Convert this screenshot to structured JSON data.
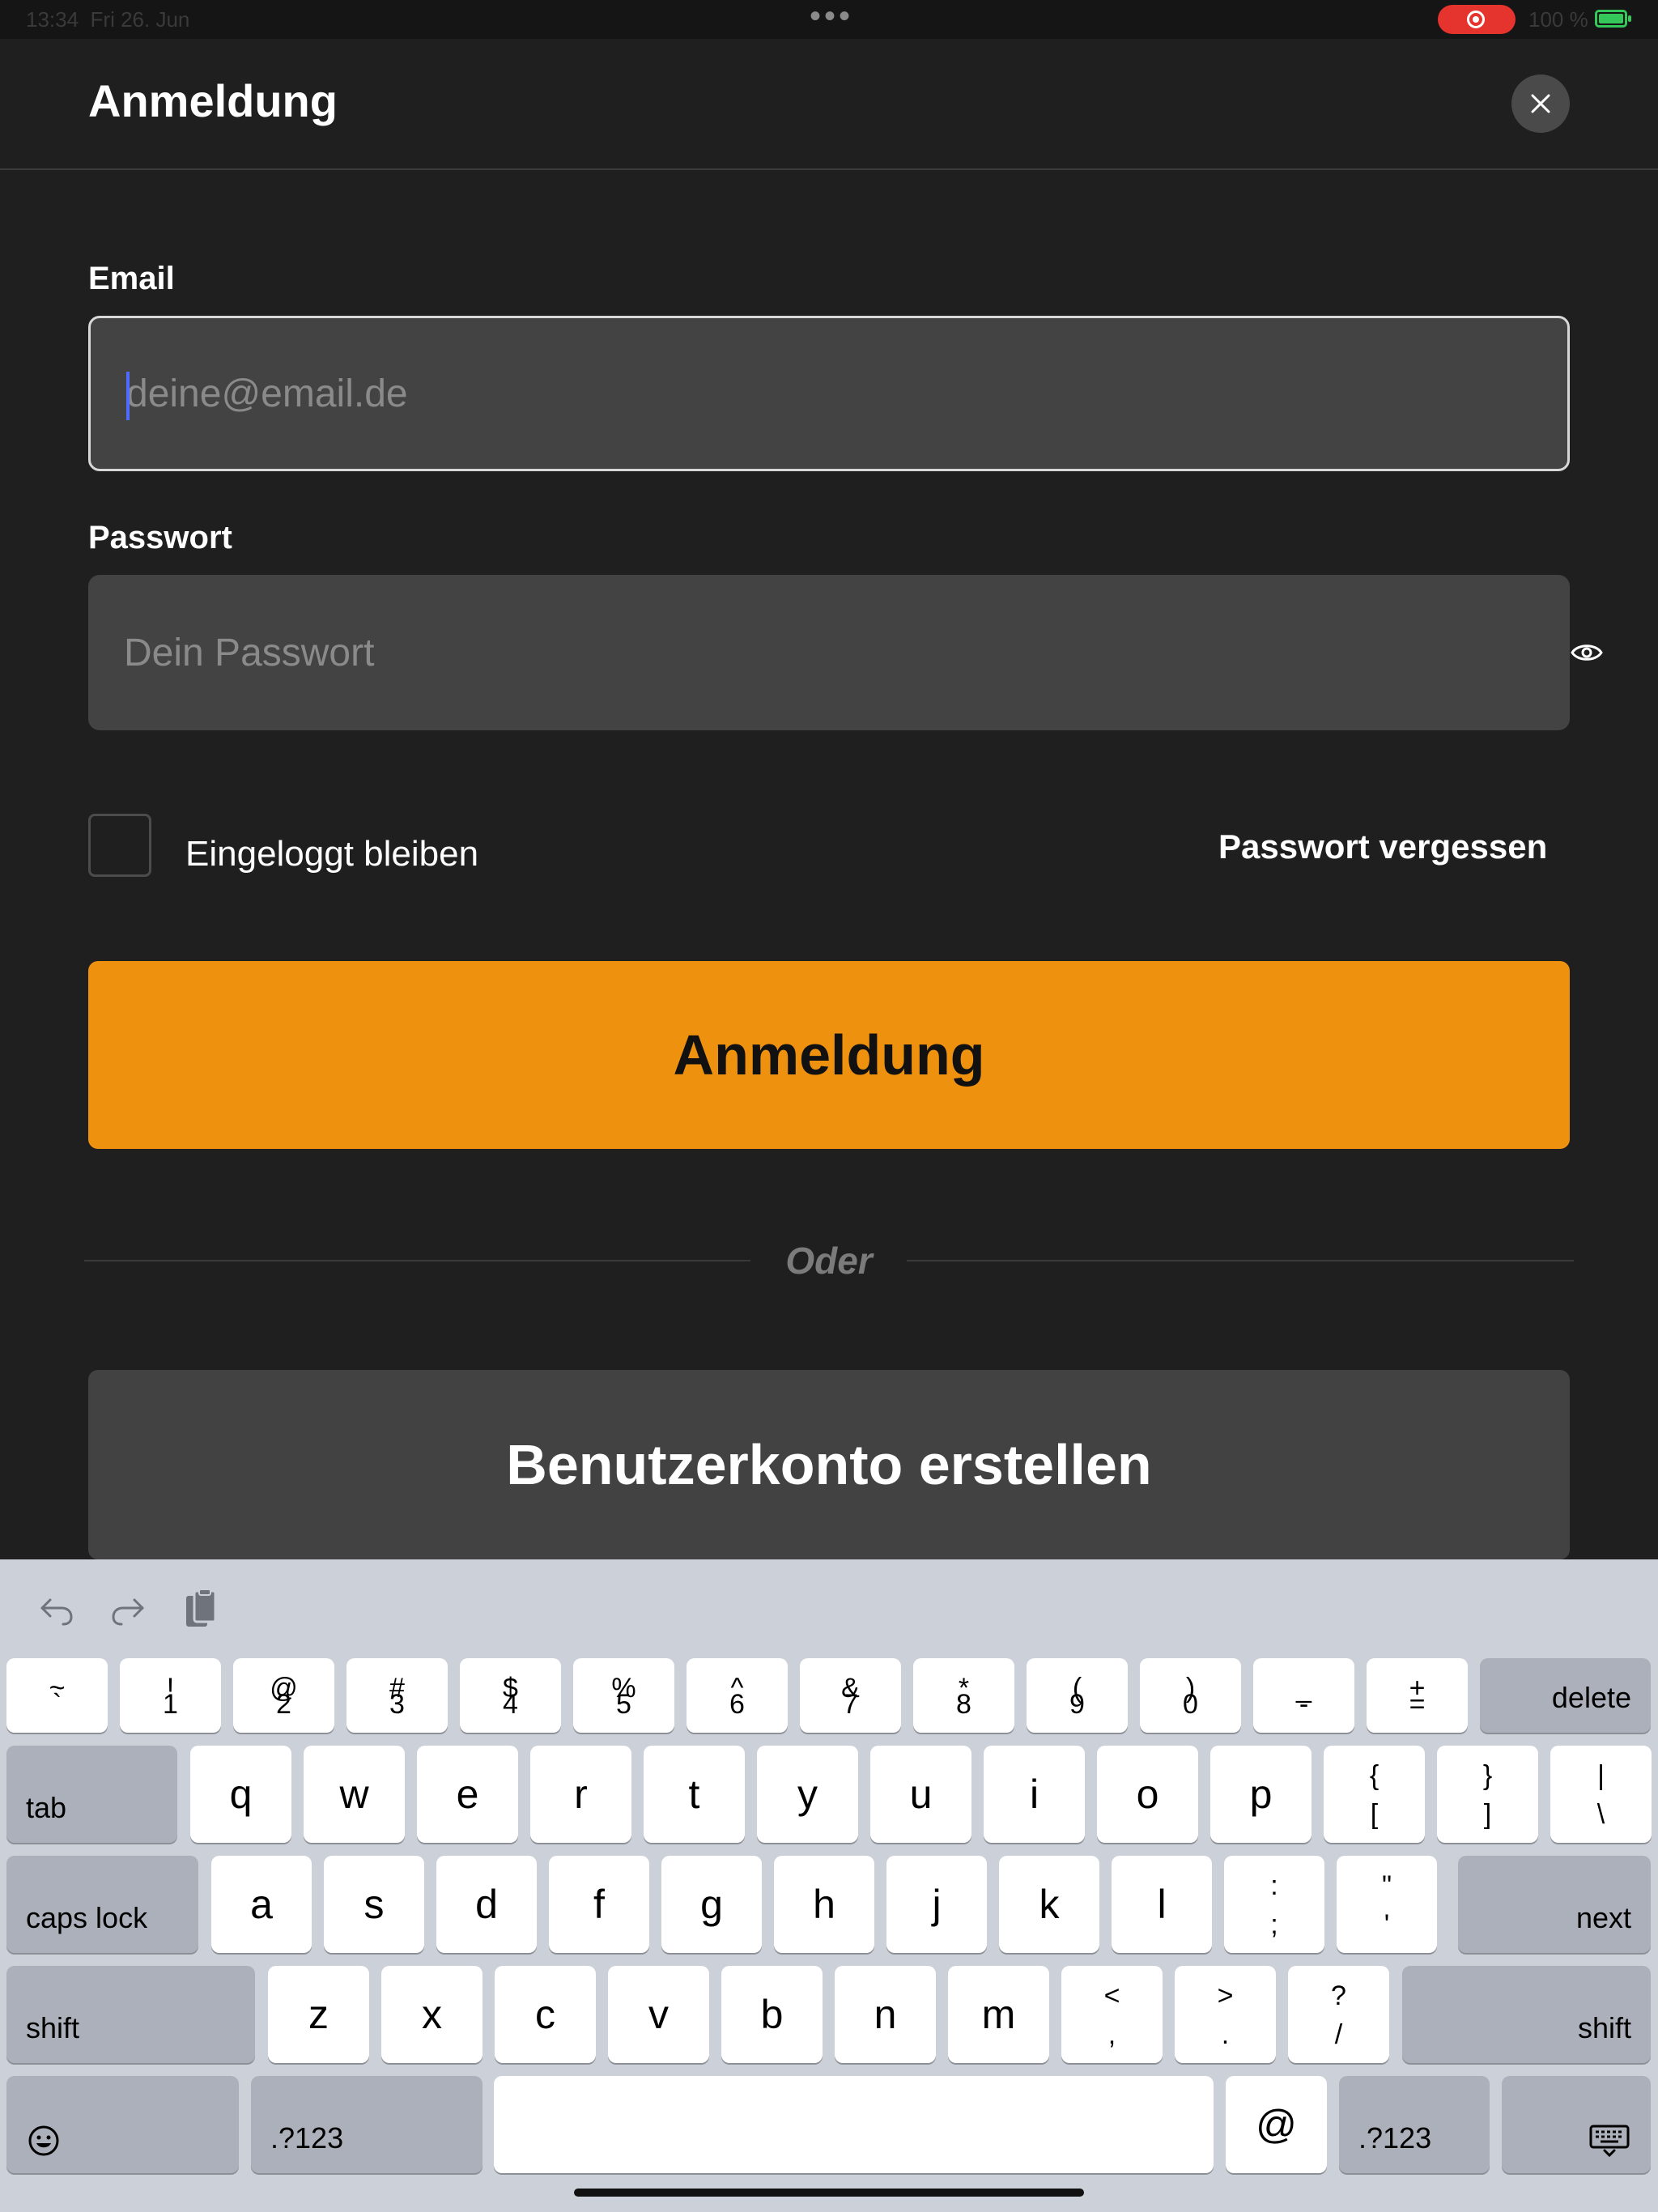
{
  "status_bar": {
    "time": "13:34",
    "date": "Fri 26. Jun",
    "battery_percent": "100 %",
    "battery_level": 1.0,
    "recording": true
  },
  "sheet": {
    "title": "Anmeldung",
    "close_icon": "close-icon"
  },
  "form": {
    "email_label": "Email",
    "email_placeholder": "deine@email.de",
    "email_value": "",
    "password_label": "Passwort",
    "password_placeholder": "Dein Passwort",
    "password_value": "",
    "remember_label": "Eingeloggt bleiben",
    "remember_checked": false,
    "forgot_label": "Passwort vergessen",
    "login_label": "Anmeldung",
    "or_label": "Oder",
    "register_label": "Benutzerkonto erstellen"
  },
  "colors": {
    "accent": "#EE910E",
    "background": "#1F1F1F",
    "field": "#434343",
    "caret": "#4F6BFF"
  },
  "keyboard": {
    "toolbar": [
      "undo-icon",
      "redo-icon",
      "clipboard-icon"
    ],
    "row1": [
      {
        "top": "~",
        "bottom": "`"
      },
      {
        "top": "!",
        "bottom": "1"
      },
      {
        "top": "@",
        "bottom": "2"
      },
      {
        "top": "#",
        "bottom": "3"
      },
      {
        "top": "$",
        "bottom": "4"
      },
      {
        "top": "%",
        "bottom": "5"
      },
      {
        "top": "^",
        "bottom": "6"
      },
      {
        "top": "&",
        "bottom": "7"
      },
      {
        "top": "*",
        "bottom": "8"
      },
      {
        "top": "(",
        "bottom": "9"
      },
      {
        "top": ")",
        "bottom": "0"
      },
      {
        "top": "_",
        "bottom": "-"
      },
      {
        "top": "+",
        "bottom": "="
      }
    ],
    "delete_label": "delete",
    "tab_label": "tab",
    "row2": [
      "q",
      "w",
      "e",
      "r",
      "t",
      "y",
      "u",
      "i",
      "o",
      "p"
    ],
    "row2_sym": [
      {
        "top": "{",
        "bottom": "["
      },
      {
        "top": "}",
        "bottom": "]"
      },
      {
        "top": "|",
        "bottom": "\\"
      }
    ],
    "caps_label": "caps lock",
    "row3": [
      "a",
      "s",
      "d",
      "f",
      "g",
      "h",
      "j",
      "k",
      "l"
    ],
    "row3_sym": [
      {
        "top": ":",
        "bottom": ";"
      },
      {
        "top": "\"",
        "bottom": "'"
      }
    ],
    "next_label": "next",
    "shift_label": "shift",
    "row4": [
      "z",
      "x",
      "c",
      "v",
      "b",
      "n",
      "m"
    ],
    "row4_sym": [
      {
        "top": "<",
        "bottom": ","
      },
      {
        "top": ">",
        "bottom": "."
      },
      {
        "top": "?",
        "bottom": "/"
      }
    ],
    "numbers_label": ".?123",
    "at_label": "@"
  }
}
